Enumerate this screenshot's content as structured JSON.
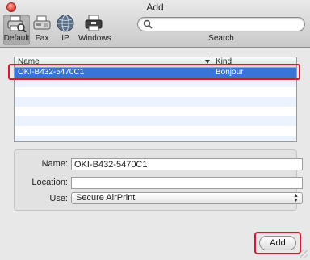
{
  "window": {
    "title": "Add"
  },
  "toolbar": {
    "items": [
      {
        "label": "Default",
        "icon": "default-printer-icon",
        "selected": true
      },
      {
        "label": "Fax",
        "icon": "fax-icon"
      },
      {
        "label": "IP",
        "icon": "globe-icon"
      },
      {
        "label": "Windows",
        "icon": "windows-printer-icon"
      }
    ],
    "search_caption": "Search",
    "search_value": ""
  },
  "list": {
    "headers": {
      "name": "Name",
      "kind": "Kind"
    },
    "rows": [
      {
        "name": "OKI-B432-5470C1",
        "kind": "Bonjour",
        "selected": true
      }
    ]
  },
  "details": {
    "name_label": "Name:",
    "name_value": "OKI-B432-5470C1",
    "location_label": "Location:",
    "location_value": "",
    "use_label": "Use:",
    "use_value": "Secure AirPrint"
  },
  "actions": {
    "add_label": "Add"
  },
  "colors": {
    "selection": "#3875d7",
    "callout": "#d8182e"
  }
}
